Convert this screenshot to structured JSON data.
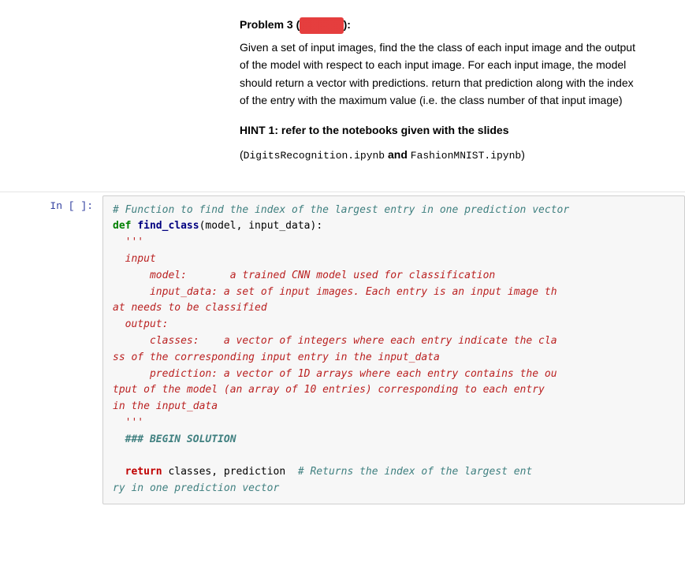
{
  "textCell": {
    "problemHeading": "Problem 3 (",
    "redactedText": "▓▓▓▓▓",
    "problemHeadingEnd": "):",
    "paragraph1": "Given a set of input images, find the the class of each input image and the output of the model with respect to each input image. For each input image, the model should return a vector with predictions. return that prediction along with the index of the entry with the maximum value (i.e. the class number of that input image)",
    "hintHeading": "HINT 1: refer to the notebooks given with the slides",
    "hintCode1": "DigitsRecognition.ipynb",
    "hintAnd": " and ",
    "hintCode2": "FashionMNIST.ipynb",
    "hintEnd": ")"
  },
  "codeCell": {
    "label": "In [ ]:",
    "comment1": "# Function to find the index of the largest entry in one prediction vector",
    "defLine": "def find_class(model, input_data):",
    "tripleQuote1": "'''",
    "inputLabel": "input",
    "modelDoc": "model:       a trained CNN model used for classification",
    "inputDataDoc": "input_data: a set of input images. Each entry is an input image that needs to be classified",
    "outputLabel": "output:",
    "classesDoc": "classes:    a vector of integers where each entry indicate the class of the corresponding input entry in the input_data",
    "predictionDoc": "prediction: a vector of 1D arrays where each entry contains the output of the model (an array of 10 entries) corresponding to each entry in the input_data",
    "tripleQuote2": "'''",
    "beginSolution": "### BEGIN SOLUTION",
    "returnLine1": "return",
    "returnLine2": "classes, prediction",
    "returnComment": "# Returns the index of the largest entry in one prediction vector"
  }
}
